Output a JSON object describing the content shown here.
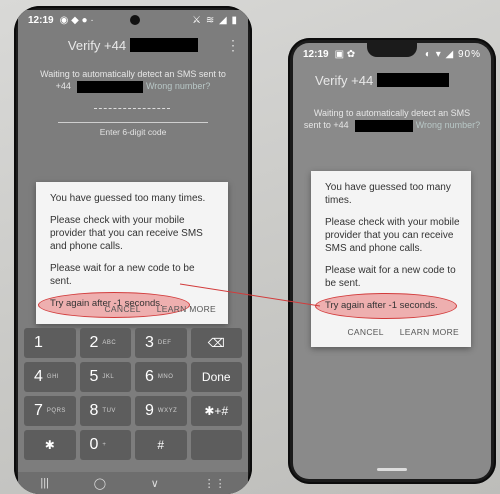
{
  "left_phone": {
    "status_time": "12:19",
    "status_icons": "◉ ◆ ● ·",
    "status_right": "⚔ ≋ ◢ ▮",
    "title": "Verify +44",
    "waiting_line1": "Waiting to automatically detect an SMS sent to",
    "waiting_prefix": "+44",
    "waiting_link": "Wrong number?",
    "code_placeholder": "Enter 6-digit code",
    "dialog": {
      "line1": "You have guessed too many times.",
      "line2": "Please check with your mobile provider that you can receive SMS and phone calls.",
      "line3": "Please wait for a new code to be sent.",
      "try_again": "Try again after -1 seconds.",
      "cancel": "CANCEL",
      "learn_more": "LEARN MORE"
    },
    "keys": [
      {
        "main": "1",
        "sub": ""
      },
      {
        "main": "2",
        "sub": "ABC"
      },
      {
        "main": "3",
        "sub": "DEF"
      },
      {
        "main": "⌫",
        "sub": ""
      },
      {
        "main": "4",
        "sub": "GHI"
      },
      {
        "main": "5",
        "sub": "JKL"
      },
      {
        "main": "6",
        "sub": "MNO"
      },
      {
        "main": "Done",
        "sub": ""
      },
      {
        "main": "7",
        "sub": "PQRS"
      },
      {
        "main": "8",
        "sub": "TUV"
      },
      {
        "main": "9",
        "sub": "WXYZ"
      },
      {
        "main": "✱+#",
        "sub": ""
      },
      {
        "main": "✱",
        "sub": ""
      },
      {
        "main": "0",
        "sub": "+"
      },
      {
        "main": "#",
        "sub": ""
      },
      {
        "main": "",
        "sub": ""
      }
    ],
    "nav": [
      "|||",
      "◯",
      "∨",
      "⋮⋮"
    ]
  },
  "right_phone": {
    "status_time": "12:19",
    "status_icons": "▣ ✿",
    "status_right": "◐ ▾ ◢ 90%",
    "title": "Verify +44",
    "waiting_line1": "Waiting to automatically detect an SMS",
    "waiting_prefix": "sent to +44",
    "waiting_link": "Wrong number?",
    "dialog": {
      "line1": "You have guessed too many times.",
      "line2": "Please check with your mobile provider that you can receive SMS and phone calls.",
      "line3": "Please wait for a new code to be sent.",
      "try_again": "Try again after -1 seconds.",
      "cancel": "CANCEL",
      "learn_more": "LEARN MORE"
    }
  }
}
